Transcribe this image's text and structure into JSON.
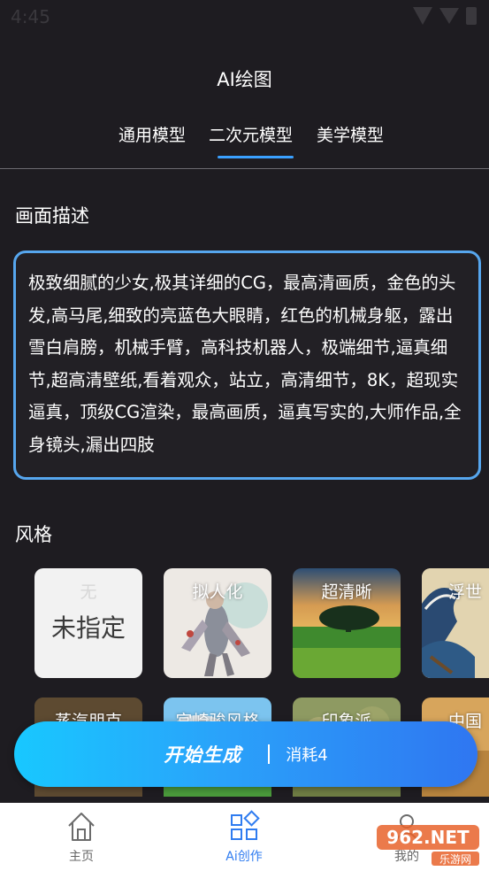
{
  "status_bar": {
    "time": "4:45"
  },
  "header": {
    "title": "AI绘图"
  },
  "tabs": [
    {
      "label": "通用模型",
      "active": false
    },
    {
      "label": "二次元模型",
      "active": true
    },
    {
      "label": "美学模型",
      "active": false
    }
  ],
  "description": {
    "label": "画面描述",
    "text": "极致细腻的少女,极其详细的CG，最高清画质，金色的头发,高马尾,细致的亮蓝色大眼睛，红色的机械身躯，露出雪白肩膀，机械手臂，高科技机器人，极端细节,逼真细节,超高清壁纸,看着观众，站立，高清细节，8K，超现实逼真，顶级CG渲染，最高画质，逼真写实的,大师作品,全身镜头,漏出四肢"
  },
  "styles": {
    "label": "风格",
    "items": [
      {
        "name": "无",
        "subtitle": "未指定",
        "icon": "none"
      },
      {
        "name": "拟人化",
        "icon": "anthropomorphic-figure"
      },
      {
        "name": "超清晰",
        "icon": "landscape-tree"
      },
      {
        "name": "浮世",
        "icon": "ukiyo-e-wave"
      },
      {
        "name": "蒸汽朋克",
        "icon": "steampunk"
      },
      {
        "name": "宫崎骏风格",
        "icon": "ghibli"
      },
      {
        "name": "印象派",
        "icon": "impressionism"
      },
      {
        "name": "中国",
        "icon": "chinese-painting"
      }
    ]
  },
  "cta": {
    "start_label": "开始生成",
    "cost_label": "消耗4"
  },
  "bottom_nav": [
    {
      "label": "主页",
      "icon": "home-icon",
      "active": false
    },
    {
      "label": "Ai创作",
      "icon": "grid-icon",
      "active": true
    },
    {
      "label": "我的",
      "icon": "user-icon",
      "active": false
    }
  ],
  "watermark": {
    "text": "962.NET",
    "sub": "乐游网"
  },
  "colors": {
    "accent": "#3aa0ff",
    "background": "#1e1c21",
    "border": "#56a6ee"
  }
}
